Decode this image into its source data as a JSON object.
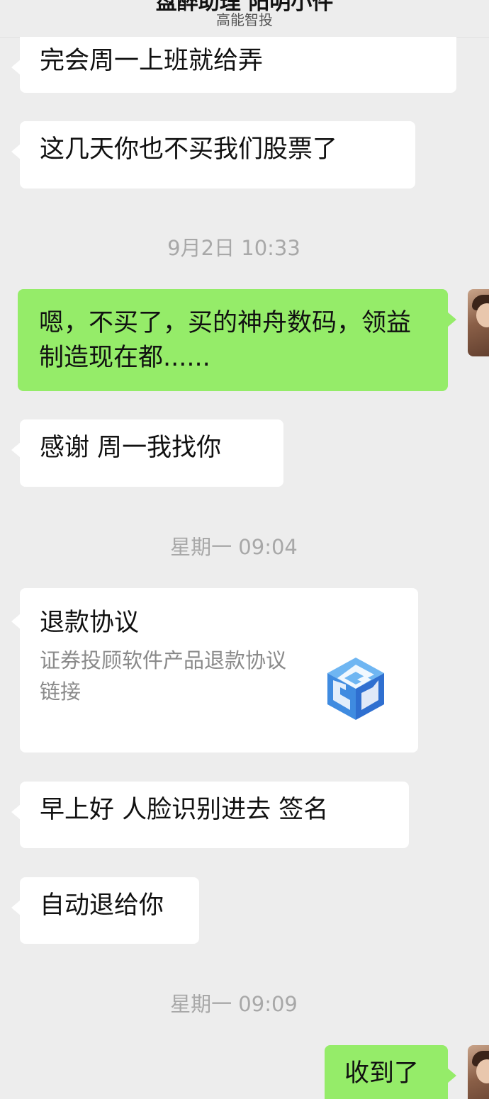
{
  "header": {
    "title": "盘醉助理     阳明小件",
    "subtitle": "高能智投"
  },
  "messages": {
    "m1": "完会周一上班就给弄",
    "m2": "这几天你也不买我们股票了",
    "t1": "9月2日 10:33",
    "m3": "嗯，不买了，买的神舟数码，领益制造现在都......",
    "m4": "感谢  周一我找你",
    "t2": "星期一 09:04",
    "card": {
      "title": "退款协议",
      "description": "证券投顾软件产品退款协议链接",
      "logo_icon": "cube-logo-icon"
    },
    "m5": "早上好   人脸识别进去  签名",
    "m6": "自动退给你",
    "t3": "星期一 09:09",
    "m7": "收到了"
  },
  "colors": {
    "background": "#ededed",
    "incoming_bubble": "#ffffff",
    "outgoing_bubble": "#95ec69",
    "timestamp": "#a8a8a8"
  }
}
